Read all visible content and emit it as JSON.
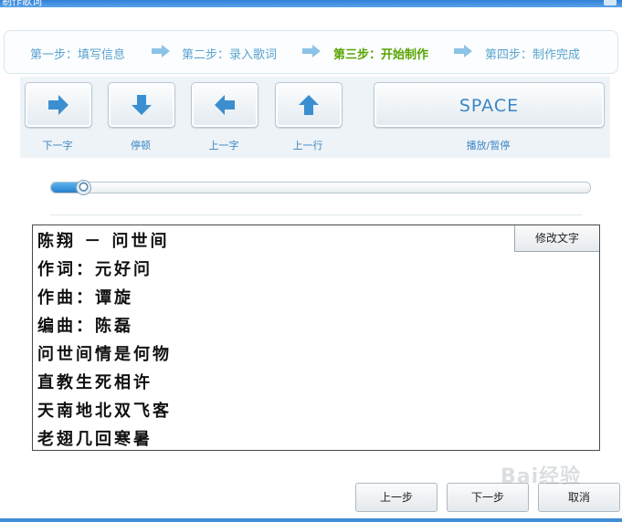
{
  "window": {
    "title": "制作歌词"
  },
  "steps": [
    {
      "label": "第一步：填写信息"
    },
    {
      "label": "第二步：录入歌词"
    },
    {
      "label": "第三步：开始制作"
    },
    {
      "label": "第四步：制作完成"
    }
  ],
  "controls": {
    "next_word": "下一字",
    "pause": "停顿",
    "prev_word": "上一字",
    "prev_line": "上一行",
    "space_key": "SPACE",
    "play_pause": "播放/暂停"
  },
  "progress": {
    "value": 0.06
  },
  "lyrics": {
    "title_line": "陈翔 － 问世间",
    "edit_button": "修改文字",
    "lines": [
      "作词：元好问",
      "作曲：谭旋",
      "编曲：陈磊",
      "问世间情是何物",
      "直教生死相许",
      "天南地北双飞客",
      "老翅几回寒暑"
    ]
  },
  "footer": {
    "prev": "上一步",
    "next": "下一步",
    "cancel": "取消"
  },
  "watermark": {
    "text": "Bai经验"
  },
  "colors": {
    "accent": "#3a86c4",
    "active_step": "#58a400",
    "titlebar": "#2f7fd6"
  }
}
